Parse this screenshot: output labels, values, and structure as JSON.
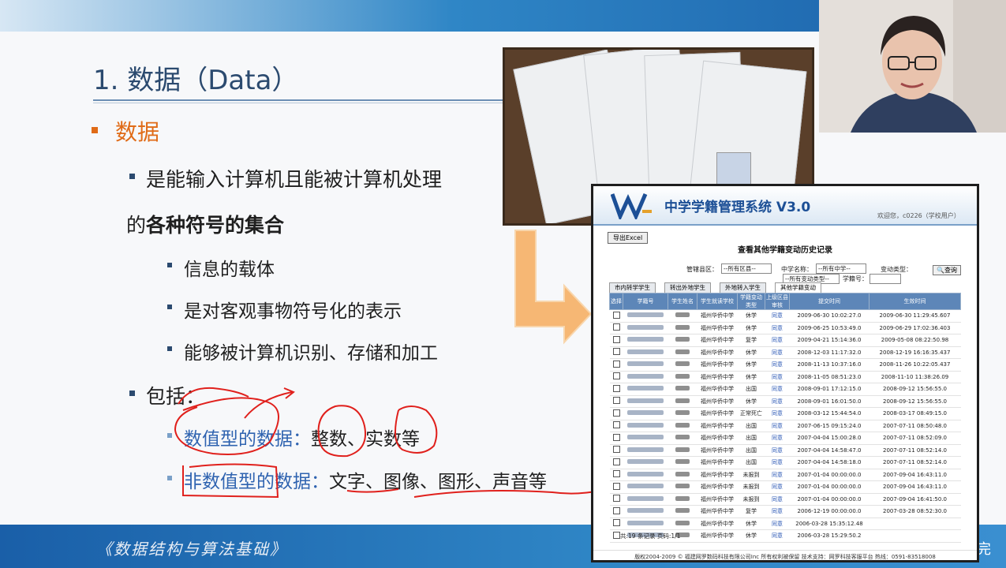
{
  "slide": {
    "title": "1. 数据（Data）",
    "heading": "数据",
    "def_line1": "是能输入计算机且能被计算机处理",
    "def_line2_prefix": "的",
    "def_line2_bold": "各种符号的集合",
    "sub1": "信息的载体",
    "sub2": "是对客观事物符号化的表示",
    "sub3": "能够被计算机识别、存储和加工",
    "include": "包括：",
    "numeric_a": "数值型",
    "numeric_b": "的数据：",
    "numeric_c": "整数、实数等",
    "non_numeric_a": "非数值型",
    "non_numeric_b": "的数据：",
    "non_numeric_c": "文字、图像、图形、声音等",
    "footer": "《数据结构与算法基础》",
    "footer_right": "完"
  },
  "colors": {
    "accent_orange": "#e06b17",
    "title_blue": "#2b4a6f",
    "link_blue": "#2f63b0",
    "annotation_red": "#e0201c",
    "table_header": "#5d86b8"
  },
  "screenshot": {
    "system_title": "中学学籍管理系统 V3.0",
    "welcome": "欢迎您，c0226（学校用户）",
    "export_button": "导出Excel",
    "page_title": "查看其他学籍变动历史记录",
    "filters": {
      "district_label": "管辖县区：",
      "district_value": "--所有区县--",
      "school_label": "中学名称：",
      "school_value": "--所有中学--",
      "change_type_label": "变动类型：",
      "change_type_value": "--所有变动类型--",
      "student_no_label": "学籍号：",
      "query_button": "查询"
    },
    "tabs": [
      "市内转学学生",
      "转出外地学生",
      "外地转入学生",
      "其他学籍变动"
    ],
    "columns": [
      "选择",
      "学籍号",
      "学生姓名",
      "学生就读学校",
      "学籍变动类型",
      "上级区县审核",
      "提交时间",
      "生效时间"
    ],
    "rows": [
      {
        "school": "福州华侨中学",
        "type": "休学",
        "audit": "同意",
        "submit": "2009-06-30 10:02:27.0",
        "effect": "2009-06-30 11:29:45.607"
      },
      {
        "school": "福州华侨中学",
        "type": "休学",
        "audit": "同意",
        "submit": "2009-06-25 10:53:49.0",
        "effect": "2009-06-29 17:02:36.403"
      },
      {
        "school": "福州华侨中学",
        "type": "复学",
        "audit": "同意",
        "submit": "2009-04-21 15:14:36.0",
        "effect": "2009-05-08 08:22:50.98"
      },
      {
        "school": "福州华侨中学",
        "type": "休学",
        "audit": "同意",
        "submit": "2008-12-03 11:17:32.0",
        "effect": "2008-12-19 16:16:35.437"
      },
      {
        "school": "福州华侨中学",
        "type": "休学",
        "audit": "同意",
        "submit": "2008-11-13 10:37:16.0",
        "effect": "2008-11-26 10:22:05.437"
      },
      {
        "school": "福州华侨中学",
        "type": "休学",
        "audit": "同意",
        "submit": "2008-11-05 08:51:23.0",
        "effect": "2008-11-10 11:38:26.09"
      },
      {
        "school": "福州华侨中学",
        "type": "出国",
        "audit": "同意",
        "submit": "2008-09-01 17:12:15.0",
        "effect": "2008-09-12 15:56:55.0"
      },
      {
        "school": "福州华侨中学",
        "type": "休学",
        "audit": "同意",
        "submit": "2008-09-01 16:01:50.0",
        "effect": "2008-09-12 15:56:55.0"
      },
      {
        "school": "福州华侨中学",
        "type": "正常死亡",
        "audit": "同意",
        "submit": "2008-03-12 15:44:54.0",
        "effect": "2008-03-17 08:49:15.0"
      },
      {
        "school": "福州华侨中学",
        "type": "出国",
        "audit": "同意",
        "submit": "2007-06-15 09:15:24.0",
        "effect": "2007-07-11 08:50:48.0"
      },
      {
        "school": "福州华侨中学",
        "type": "出国",
        "audit": "同意",
        "submit": "2007-04-04 15:00:28.0",
        "effect": "2007-07-11 08:52:09.0"
      },
      {
        "school": "福州华侨中学",
        "type": "出国",
        "audit": "同意",
        "submit": "2007-04-04 14:58:47.0",
        "effect": "2007-07-11 08:52:14.0"
      },
      {
        "school": "福州华侨中学",
        "type": "出国",
        "audit": "同意",
        "submit": "2007-04-04 14:58:18.0",
        "effect": "2007-07-11 08:52:14.0"
      },
      {
        "school": "福州华侨中学",
        "type": "未报到",
        "audit": "同意",
        "submit": "2007-01-04 00:00:00.0",
        "effect": "2007-09-04 16:43:11.0"
      },
      {
        "school": "福州华侨中学",
        "type": "未报到",
        "audit": "同意",
        "submit": "2007-01-04 00:00:00.0",
        "effect": "2007-09-04 16:43:11.0"
      },
      {
        "school": "福州华侨中学",
        "type": "未报到",
        "audit": "同意",
        "submit": "2007-01-04 00:00:00.0",
        "effect": "2007-09-04 16:41:50.0"
      },
      {
        "school": "福州华侨中学",
        "type": "复学",
        "audit": "同意",
        "submit": "2006-12-19 00:00:00.0",
        "effect": "2007-03-28 08:52:30.0"
      },
      {
        "school": "福州华侨中学",
        "type": "休学",
        "audit": "同意",
        "submit": "2006-03-28 15:35:12.48",
        "effect": ""
      },
      {
        "school": "福州华侨中学",
        "type": "休学",
        "audit": "同意",
        "submit": "2006-03-28 15:29:50.2",
        "effect": ""
      }
    ],
    "count_text": "共:19 条记录  页码:1/1",
    "copyright": "版权2004-2009 © 福建网罗数码科技有限公司Inc 所有权利被保留  技术支持：网罗科技客服平台  热线：0591-83518008"
  }
}
